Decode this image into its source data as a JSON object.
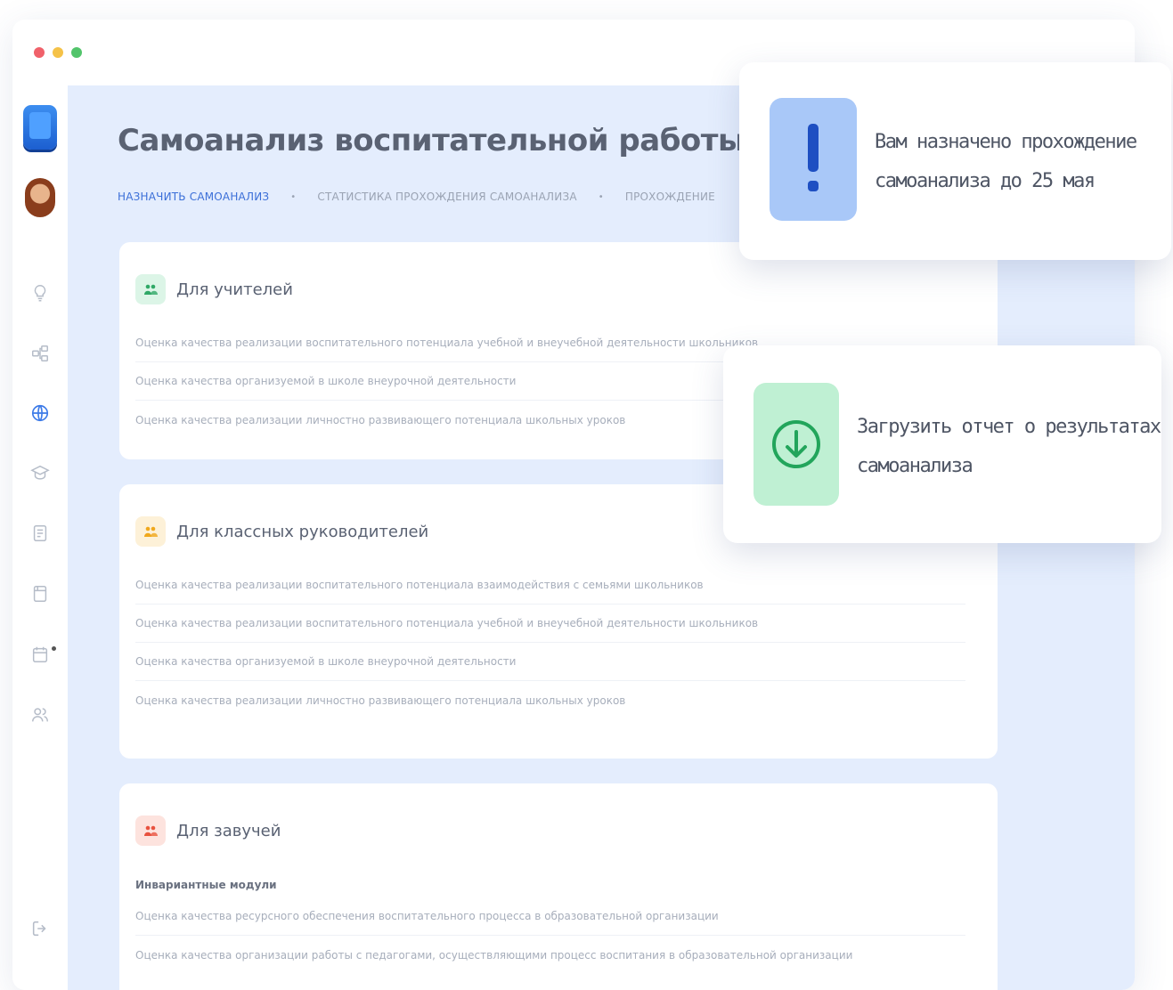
{
  "window_controls": [
    "close",
    "minimize",
    "maximize"
  ],
  "sidebar": {
    "icons": [
      {
        "name": "lightbulb-icon",
        "active": false
      },
      {
        "name": "structure-icon",
        "active": false
      },
      {
        "name": "globe-icon",
        "active": true
      },
      {
        "name": "graduation-cap-icon",
        "active": false
      },
      {
        "name": "document-icon",
        "active": false
      },
      {
        "name": "notebook-icon",
        "active": false
      },
      {
        "name": "calendar-icon",
        "active": false,
        "badge": true
      },
      {
        "name": "users-icon",
        "active": false
      }
    ],
    "logout_icon": "logout-icon"
  },
  "page": {
    "title": "Самоанализ воспитательной работы",
    "tabs": [
      {
        "label": "НАЗНАЧИТЬ САМОАНАЛИЗ",
        "active": true
      },
      {
        "label": "СТАТИСТИКА ПРОХОЖДЕНИЯ САМОАНАЛИЗА",
        "active": false
      },
      {
        "label": "ПРОХОЖДЕНИЕ",
        "active": false
      }
    ]
  },
  "cards": [
    {
      "title": "Для учителей",
      "icon_color": "#2fa866",
      "icon_bg": "#dcf5e7",
      "rows": [
        "Оценка качества реализации воспитательного потенциала учебной и внеучебной деятельности школьников",
        "Оценка качества организуемой в школе внеурочной деятельности",
        "Оценка качества реализации личностно развивающего потенциала школьных уроков"
      ]
    },
    {
      "title": "Для классных руководителей",
      "icon_color": "#f0a81c",
      "icon_bg": "#fdf1d8",
      "rows": [
        "Оценка качества реализации воспитательного потенциала взаимодействия с семьями школьников",
        "Оценка качества реализации воспитательного потенциала учебной и внеучебной деятельности школьников",
        "Оценка качества организуемой в школе внеурочной деятельности",
        "Оценка качества реализации личностно развивающего потенциала школьных уроков"
      ]
    },
    {
      "title": "Для завучей",
      "icon_color": "#e8523f",
      "icon_bg": "#fde3de",
      "subheading": "Инвариантные модули",
      "rows": [
        "Оценка качества ресурсного обеспечения воспитательного процесса в образовательной организации",
        "Оценка качества организации работы с педагогами, осуществляющими процесс воспитания в образовательной организации"
      ]
    }
  ],
  "popups": [
    {
      "icon": "exclamation-icon",
      "icon_bg": "#a9c8f8",
      "icon_color": "#1e4fc2",
      "line1": "Вам назначено прохождение",
      "line2": "самоанализа до 25 мая"
    },
    {
      "icon": "download-icon",
      "icon_bg": "#bff0d3",
      "icon_color": "#22a55b",
      "line1": "Загрузить отчет о результатах",
      "line2": "самоанализа"
    }
  ]
}
